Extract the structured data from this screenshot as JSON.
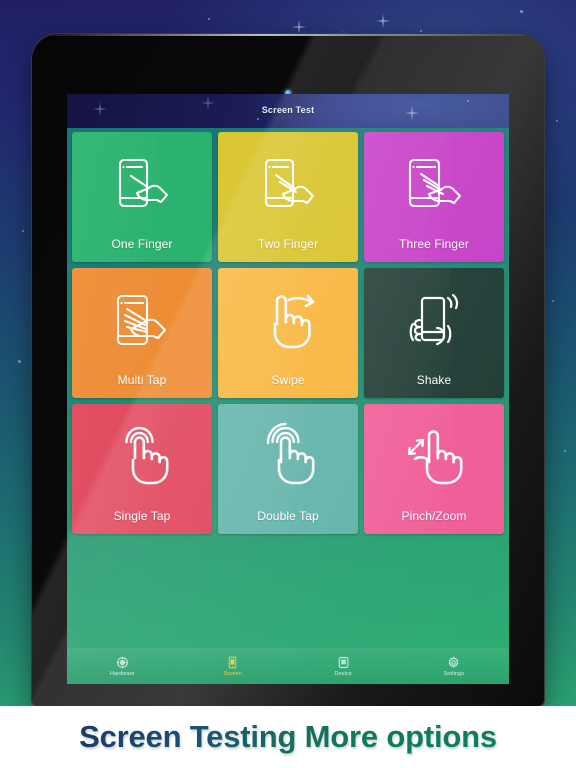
{
  "app": {
    "title": "Screen Test",
    "tiles": [
      {
        "label": "One Finger",
        "icon": "one-finger-icon",
        "color": "#2AB26E"
      },
      {
        "label": "Two Finger",
        "icon": "two-finger-icon",
        "color": "#D9C329"
      },
      {
        "label": "Three Finger",
        "icon": "three-finger-icon",
        "color": "#C63CC6"
      },
      {
        "label": "Multi Tap",
        "icon": "multi-tap-icon",
        "color": "#EE8B33"
      },
      {
        "label": "Swipe",
        "icon": "swipe-icon",
        "color": "#F9B53C"
      },
      {
        "label": "Shake",
        "icon": "shake-icon",
        "color": "#1E3A33"
      },
      {
        "label": "Single Tap",
        "icon": "single-tap-icon",
        "color": "#E0455A"
      },
      {
        "label": "Double Tap",
        "icon": "double-tap-icon",
        "color": "#61B3AA"
      },
      {
        "label": "Pinch/Zoom",
        "icon": "pinch-zoom-icon",
        "color": "#F05B96"
      }
    ],
    "tabs": [
      {
        "label": "Hardware",
        "icon": "hardware-icon",
        "active": false
      },
      {
        "label": "Screen",
        "icon": "screen-icon",
        "active": true
      },
      {
        "label": "Device",
        "icon": "device-icon",
        "active": false
      },
      {
        "label": "Settings",
        "icon": "settings-icon",
        "active": false
      }
    ],
    "active_tab_color": "#EAD143"
  },
  "banner": {
    "text": "Screen Testing More options",
    "gradient_from": "#1F3A6E",
    "gradient_to": "#0D7F63",
    "background": "#FFFFFF"
  },
  "device": {
    "frame_color": "#0A0A0A",
    "backdrop_from": "#211F63",
    "backdrop_to": "#2AA172"
  }
}
